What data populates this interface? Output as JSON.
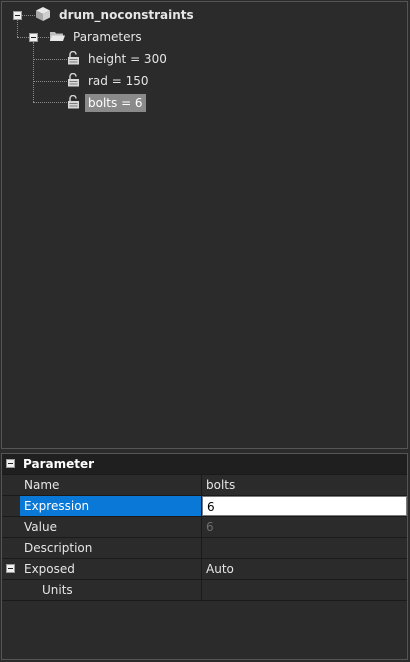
{
  "tree": {
    "root": {
      "label": "drum_noconstraints",
      "icon": "part-cube-icon",
      "expanded": true
    },
    "folder": {
      "label": "Parameters",
      "icon": "folder-open-icon",
      "expanded": true
    },
    "items": [
      {
        "label": "height = 300",
        "icon": "unlocked-padlock-icon",
        "selected": false
      },
      {
        "label": "rad = 150",
        "icon": "unlocked-padlock-icon",
        "selected": false
      },
      {
        "label": "bolts = 6",
        "icon": "unlocked-padlock-icon",
        "selected": true
      }
    ]
  },
  "properties": {
    "category": "Parameter",
    "rows": [
      {
        "name": "Name",
        "value": "bolts"
      },
      {
        "name": "Expression",
        "value": "6"
      },
      {
        "name": "Value",
        "value": "6"
      },
      {
        "name": "Description",
        "value": ""
      },
      {
        "name": "Exposed",
        "value": "Auto"
      },
      {
        "name": "Units",
        "value": ""
      }
    ]
  },
  "colors": {
    "background": "#2b2b2b",
    "selection_tree": "#8a8a8a",
    "selection_grid": "#0a78d7",
    "edit_field": "#ffffff"
  }
}
